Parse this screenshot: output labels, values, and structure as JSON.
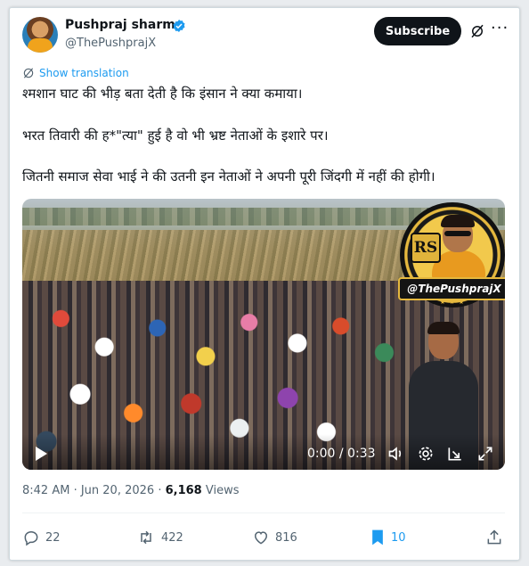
{
  "author": {
    "name": "Pushpraj sharma",
    "handle": "@ThePushprajX",
    "verified": true
  },
  "header": {
    "subscribe_label": "Subscribe",
    "more_label": "···"
  },
  "translation": {
    "label": "Show translation"
  },
  "post": {
    "line1": "श्मशान घाट की भीड़ बता देती है कि इंसान ने क्या कमाया।",
    "line2": "भरत तिवारी की ह*\"त्या\" हुई है वो भी भ्रष्ट नेताओं के इशारे पर।",
    "line3": "जितनी समाज सेवा भाई ने की उतनी इन नेताओं ने अपनी पूरी जिंदगी में नहीं की होगी।"
  },
  "video": {
    "watermark_initials": "RS",
    "watermark_text": "@ThePushprajX",
    "watermark_stars": "★ ★ ★",
    "time_display": "0:00 / 0:33"
  },
  "meta": {
    "time": "8:42 AM",
    "separator": " · ",
    "date": "Jun 20, 2026",
    "views_count": "6,168",
    "views_label": " Views"
  },
  "actions": {
    "replies": "22",
    "reposts": "422",
    "likes": "816",
    "bookmarks": "10"
  },
  "colors": {
    "accent": "#1d9bf0",
    "text": "#0f1419",
    "muted": "#536471"
  },
  "icons": [
    "verified-badge-icon",
    "grok-icon",
    "more-icon",
    "translate-icon",
    "play-icon",
    "volume-icon",
    "settings-icon",
    "pip-icon",
    "fullscreen-icon",
    "reply-icon",
    "repost-icon",
    "like-icon",
    "bookmark-icon",
    "share-icon"
  ]
}
